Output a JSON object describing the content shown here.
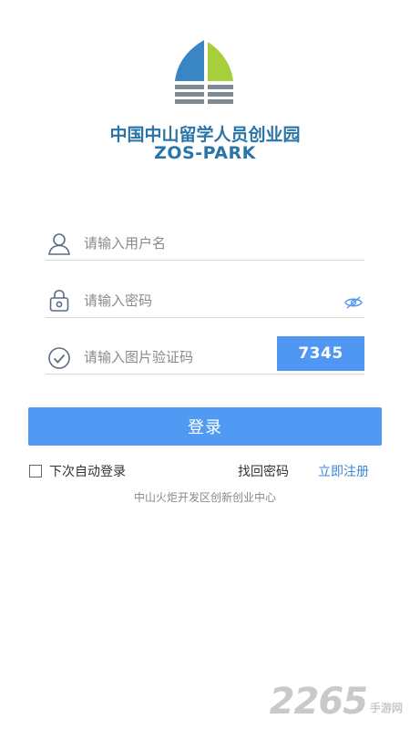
{
  "app": {
    "org_name_cn": "中国中山留学人员创业园",
    "org_name_en": "ZOS-PARK"
  },
  "form": {
    "username_placeholder": "请输入用户名",
    "password_placeholder": "请输入密码",
    "captcha_placeholder": "请输入图片验证码",
    "captcha_code": "7345",
    "login_label": "登录",
    "auto_login_label": "下次自动登录",
    "auto_login_checked": false,
    "forgot_label": "找回密码",
    "register_label": "立即注册"
  },
  "footer": {
    "text": "中山火炬开发区创新创业中心"
  },
  "watermark": {
    "number": "2265",
    "site": "手游网"
  },
  "colors": {
    "brand_blue": "#2a74a8",
    "button_blue": "#519af4",
    "link_blue": "#3b86d8",
    "logo_green": "#a7cf3c",
    "logo_gray": "#7d8a93"
  }
}
